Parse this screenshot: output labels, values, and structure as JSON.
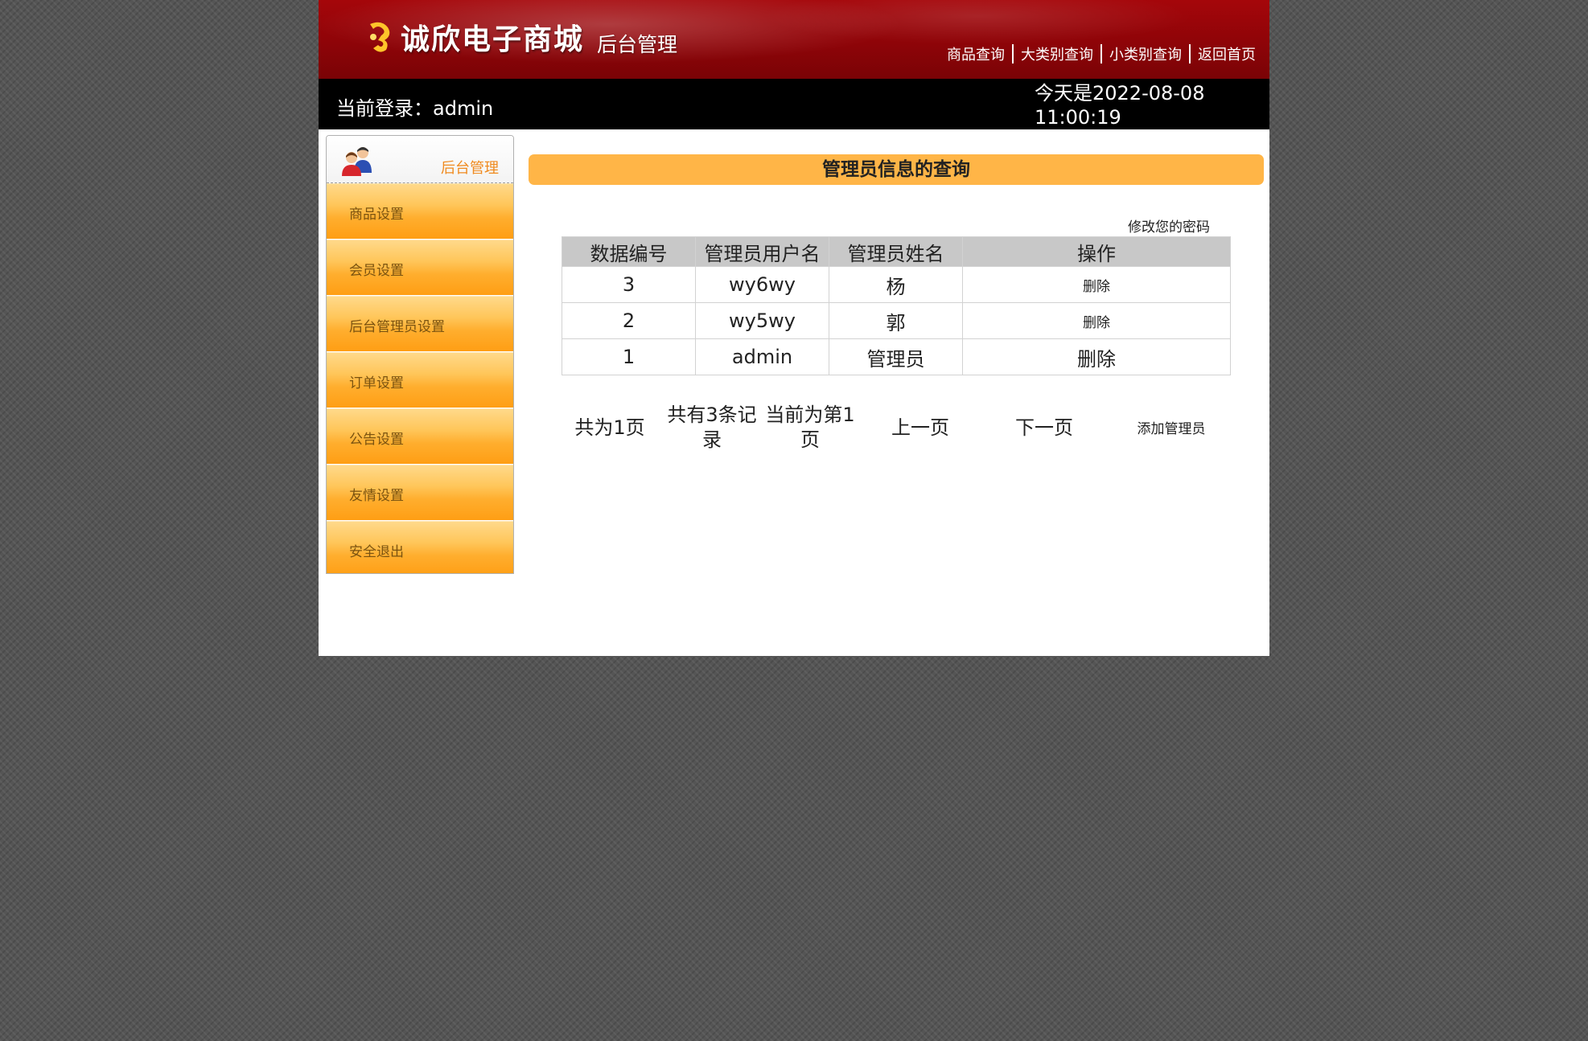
{
  "header": {
    "brand_title": "诚欣电子商城",
    "brand_subtitle": "后台管理",
    "nav": [
      "商品查询",
      "大类别查询",
      "小类别查询",
      "返回首页"
    ]
  },
  "status": {
    "login_text": "当前登录：admin",
    "date_line": "今天是2022-08-08",
    "time_line": "11:00:19"
  },
  "sidebar": {
    "title": "后台管理",
    "items": [
      "商品设置",
      "会员设置",
      "后台管理员设置",
      "订单设置",
      "公告设置",
      "友情设置",
      "安全退出"
    ]
  },
  "main": {
    "title": "管理员信息的查询",
    "change_password": "修改您的密码",
    "table": {
      "headers": [
        "数据编号",
        "管理员用户名",
        "管理员姓名",
        "操作"
      ],
      "rows": [
        {
          "id": "3",
          "username": "wy6wy",
          "name": "杨",
          "action": "删除"
        },
        {
          "id": "2",
          "username": "wy5wy",
          "name": "郭",
          "action": "删除"
        },
        {
          "id": "1",
          "username": "admin",
          "name": "管理员",
          "action": "删除"
        }
      ]
    },
    "pager": {
      "total_pages": "共为1页",
      "total_records": "共有3条记录",
      "current_page": "当前为第1页",
      "prev": "上一页",
      "next": "下一页",
      "add_admin": "添加管理员"
    }
  },
  "colors": {
    "banner": "#8e0408",
    "accent_orange": "#ffb547",
    "sidebar_title": "#f08a1e",
    "status_bar": "#000000"
  },
  "icons": {
    "logo": "logo-icon",
    "sidebar_head": "users-icon"
  }
}
